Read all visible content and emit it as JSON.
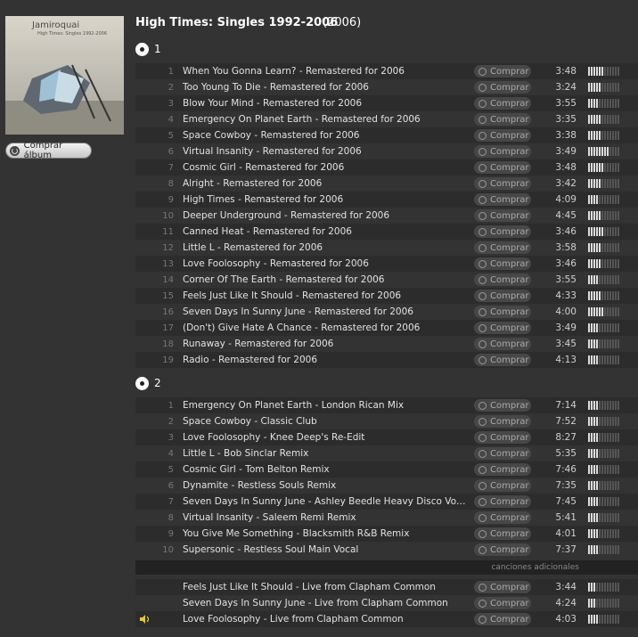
{
  "album": {
    "title": "High Times: Singles 1992-2006",
    "year": "(2006)",
    "cover_band": "Jamiroquai",
    "cover_sub": "High Times: Singles 1992-2006",
    "buy_label": "Comprar álbum"
  },
  "buy_label": "Comprar",
  "discs": [
    {
      "label": "1",
      "tracks": [
        {
          "n": "1",
          "title": "When You Gonna Learn? - Remastered for 2006",
          "duration": "3:48",
          "popularity": 6
        },
        {
          "n": "2",
          "title": "Too Young To Die - Remastered for 2006",
          "duration": "3:24",
          "popularity": 5
        },
        {
          "n": "3",
          "title": "Blow Your Mind - Remastered for 2006",
          "duration": "3:55",
          "popularity": 4
        },
        {
          "n": "4",
          "title": "Emergency On Planet Earth - Remastered for 2006",
          "duration": "3:35",
          "popularity": 5
        },
        {
          "n": "5",
          "title": "Space Cowboy - Remastered for 2006",
          "duration": "3:38",
          "popularity": 5
        },
        {
          "n": "6",
          "title": "Virtual Insanity - Remastered for 2006",
          "duration": "3:49",
          "popularity": 8
        },
        {
          "n": "7",
          "title": "Cosmic Girl - Remastered for 2006",
          "duration": "3:48",
          "popularity": 6
        },
        {
          "n": "8",
          "title": "Alright - Remastered for 2006",
          "duration": "3:42",
          "popularity": 5
        },
        {
          "n": "9",
          "title": "High Times - Remastered for 2006",
          "duration": "4:09",
          "popularity": 4
        },
        {
          "n": "10",
          "title": "Deeper Underground - Remastered for 2006",
          "duration": "4:45",
          "popularity": 5
        },
        {
          "n": "11",
          "title": "Canned Heat - Remastered for 2006",
          "duration": "3:46",
          "popularity": 6
        },
        {
          "n": "12",
          "title": "Little L - Remastered for 2006",
          "duration": "3:58",
          "popularity": 5
        },
        {
          "n": "13",
          "title": "Love Foolosophy - Remastered for 2006",
          "duration": "3:46",
          "popularity": 5
        },
        {
          "n": "14",
          "title": "Corner Of The Earth - Remastered for 2006",
          "duration": "3:55",
          "popularity": 4
        },
        {
          "n": "15",
          "title": "Feels Just Like It Should - Remastered for 2006",
          "duration": "4:33",
          "popularity": 5
        },
        {
          "n": "16",
          "title": "Seven Days In Sunny June - Remastered for 2006",
          "duration": "4:00",
          "popularity": 6
        },
        {
          "n": "17",
          "title": "(Don't) Give Hate A Chance - Remastered for 2006",
          "duration": "3:49",
          "popularity": 4
        },
        {
          "n": "18",
          "title": "Runaway - Remastered for 2006",
          "duration": "3:45",
          "popularity": 4
        },
        {
          "n": "19",
          "title": "Radio - Remastered for 2006",
          "duration": "4:13",
          "popularity": 4
        }
      ]
    },
    {
      "label": "2",
      "tracks": [
        {
          "n": "1",
          "title": "Emergency On Planet Earth - London Rican Mix",
          "duration": "7:14",
          "popularity": 4
        },
        {
          "n": "2",
          "title": "Space Cowboy - Classic Club",
          "duration": "7:52",
          "popularity": 4
        },
        {
          "n": "3",
          "title": "Love Foolosophy - Knee Deep's Re-Edit",
          "duration": "8:27",
          "popularity": 4
        },
        {
          "n": "4",
          "title": "Little L - Bob Sinclar Remix",
          "duration": "5:35",
          "popularity": 4
        },
        {
          "n": "5",
          "title": "Cosmic Girl - Tom Belton Remix",
          "duration": "7:46",
          "popularity": 4
        },
        {
          "n": "6",
          "title": "Dynamite - Restless Souls Remix",
          "duration": "7:35",
          "popularity": 4
        },
        {
          "n": "7",
          "title": "Seven Days In Sunny June - Ashley Beedle Heavy Disco Vocal Re-Edit",
          "duration": "7:45",
          "popularity": 4
        },
        {
          "n": "8",
          "title": "Virtual Insanity - Saleem Remi Remix",
          "duration": "5:41",
          "popularity": 4
        },
        {
          "n": "9",
          "title": "You Give Me Something - Blacksmith R&B Remix",
          "duration": "4:01",
          "popularity": 4
        },
        {
          "n": "10",
          "title": "Supersonic - Restless Soul Main Vocal",
          "duration": "7:37",
          "popularity": 4
        }
      ]
    }
  ],
  "extra": {
    "label": "canciones adicionales",
    "tracks": [
      {
        "n": "",
        "title": "Feels Just Like It Should - Live from Clapham Common",
        "duration": "3:44",
        "popularity": 3,
        "playing": false
      },
      {
        "n": "",
        "title": "Seven Days In Sunny June - Live from Clapham Common",
        "duration": "4:24",
        "popularity": 3,
        "playing": false
      },
      {
        "n": "",
        "title": "Love Foolosophy - Live from Clapham Common",
        "duration": "4:03",
        "popularity": 4,
        "playing": true
      }
    ]
  },
  "colors": {
    "background": "#333333",
    "row_alt": "#2c2c2c",
    "speaker": "#e8c832"
  },
  "icons": {
    "disc": "disc-icon",
    "buy": "buy-icon",
    "playing": "speaker-icon"
  }
}
